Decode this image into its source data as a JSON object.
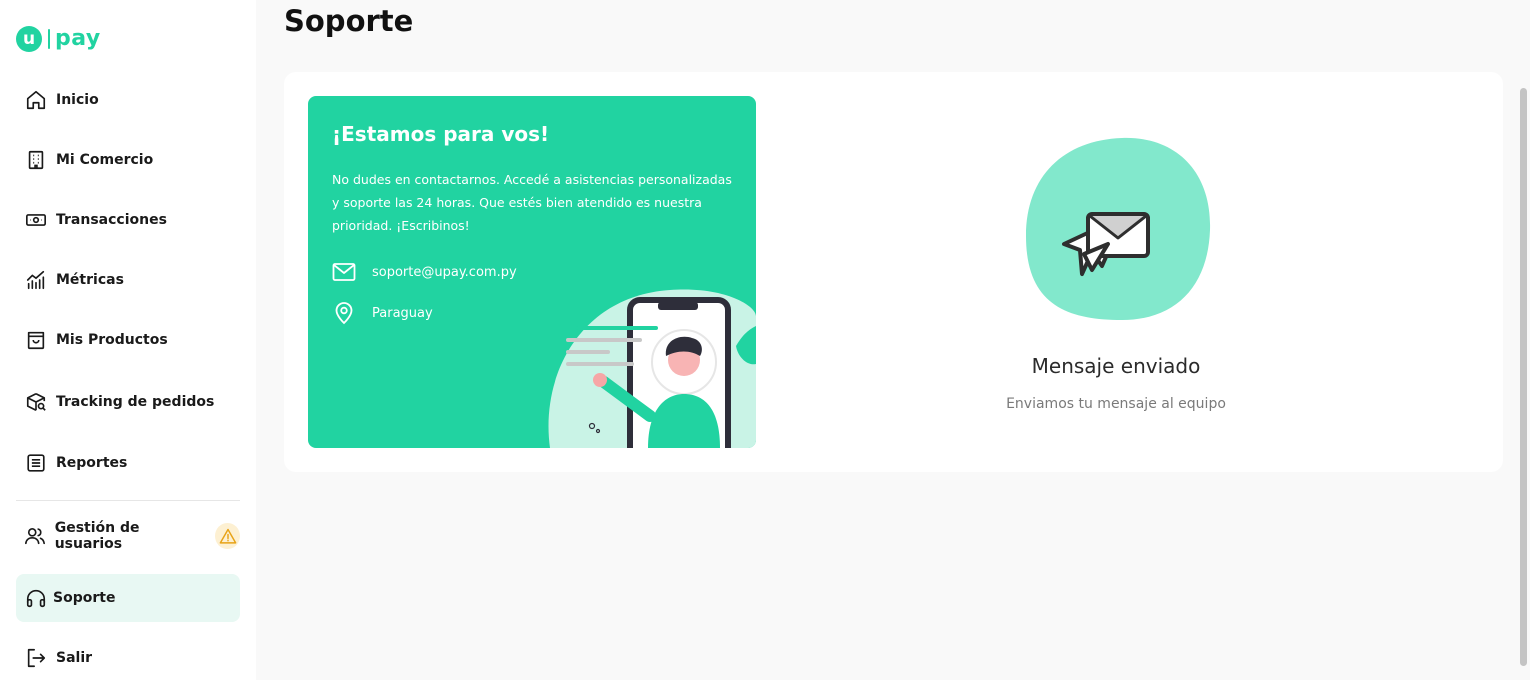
{
  "brand": {
    "logo_letter": "u",
    "logo_text": "pay",
    "accent": "#21d3a1"
  },
  "sidebar": {
    "items": [
      {
        "label": "Inicio",
        "icon": "home-icon"
      },
      {
        "label": "Mi Comercio",
        "icon": "building-icon"
      },
      {
        "label": "Transacciones",
        "icon": "cash-icon"
      },
      {
        "label": "Métricas",
        "icon": "chart-icon"
      },
      {
        "label": "Mis Productos",
        "icon": "bag-icon"
      },
      {
        "label": "Tracking de pedidos",
        "icon": "package-search-icon"
      },
      {
        "label": "Reportes",
        "icon": "report-icon"
      },
      {
        "label": "Gestión de usuarios",
        "icon": "users-icon",
        "badge": "warning-icon"
      },
      {
        "label": "Soporte",
        "icon": "headset-icon",
        "active": true
      },
      {
        "label": "Salir",
        "icon": "logout-icon"
      }
    ]
  },
  "page": {
    "title": "Soporte"
  },
  "promo": {
    "title": "¡Estamos para vos!",
    "description": "No dudes en contactarnos. Accedé a asistencias personalizadas y soporte las 24 horas. Que estés bien atendido es nuestra prioridad. ¡Escribinos!",
    "email": "soporte@upay.com.py",
    "location": "Paraguay",
    "bg_color": "#21d3a1"
  },
  "message": {
    "title": "Mensaje enviado",
    "subtitle": "Enviamos tu mensaje al equipo",
    "icon": "mail-chat-icon",
    "blob_color": "#82e8cc"
  }
}
